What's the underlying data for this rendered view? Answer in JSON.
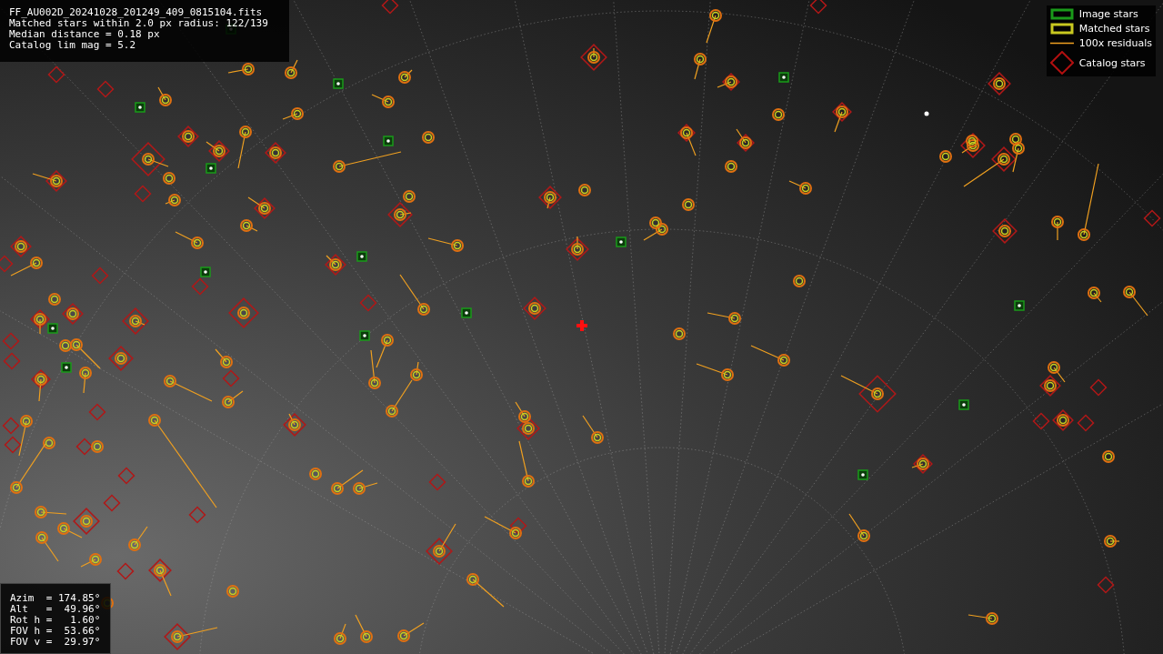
{
  "info_box": {
    "lines": [
      "FF_AU002D_20241028_201249_409_0815104.fits",
      "Matched stars within 2.0 px radius: 122/139",
      "Median distance = 0.18 px",
      "Catalog lim mag = 5.2"
    ]
  },
  "legend": [
    {
      "kind": "image",
      "label": "Image stars"
    },
    {
      "kind": "matched",
      "label": "Matched stars"
    },
    {
      "kind": "residual",
      "label": "100x residuals"
    },
    {
      "kind": "catalog",
      "label": "Catalog stars"
    }
  ],
  "pointing_box": {
    "lines": [
      "Azim  = 174.85°",
      "Alt   =  49.96°",
      "Rot h =   1.60°",
      "FOV h =  53.66°",
      "FOV v =  29.97°"
    ]
  }
}
